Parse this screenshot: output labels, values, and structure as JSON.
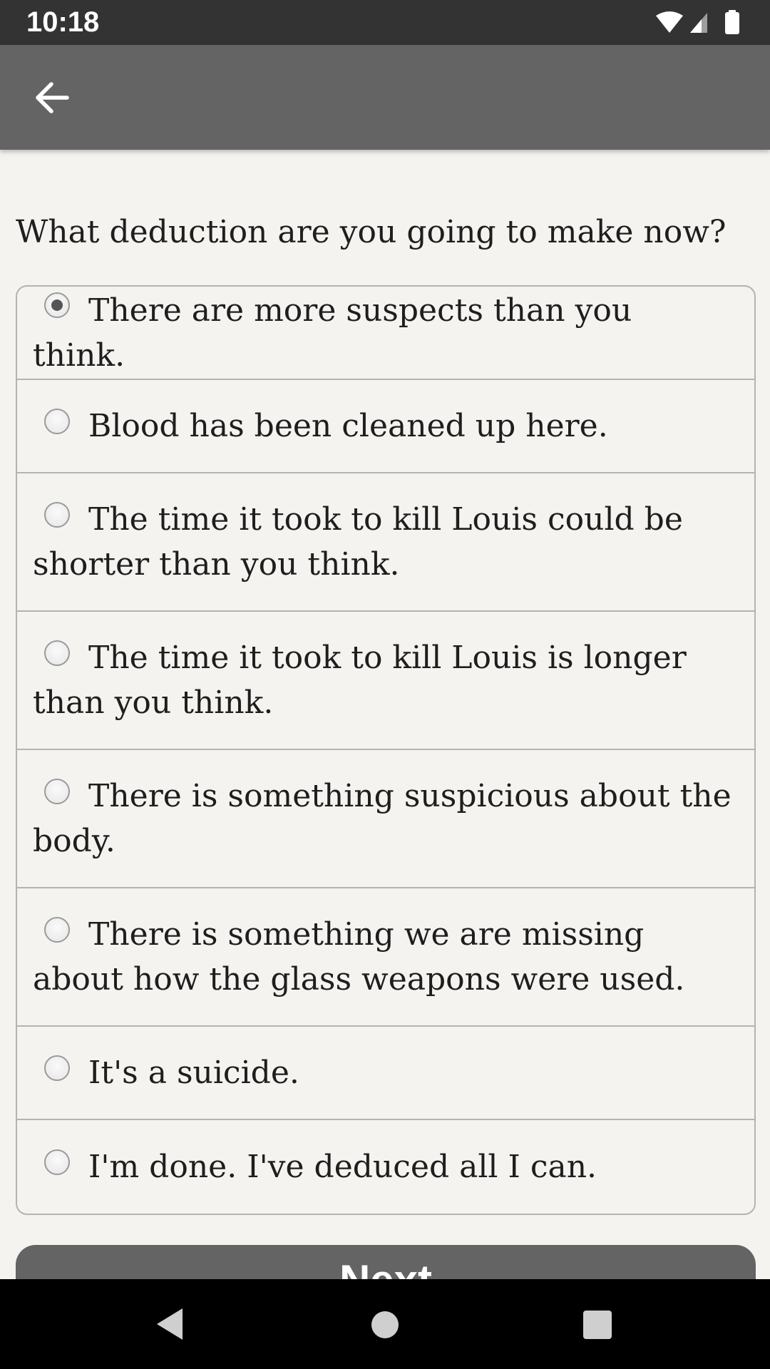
{
  "status_bar": {
    "time": "10:18",
    "icons": [
      "wifi-icon",
      "signal-icon",
      "battery-icon"
    ]
  },
  "app_bar": {
    "back_icon": "arrow-back-icon"
  },
  "question": "What deduction are you going to make now?",
  "options": [
    {
      "label": "There are more suspects than you think.",
      "selected": true
    },
    {
      "label": "Blood has been cleaned up here.",
      "selected": false
    },
    {
      "label": "The time it took to kill Louis could be shorter than you think.",
      "selected": false
    },
    {
      "label": "The time it took to kill Louis is longer than you think.",
      "selected": false
    },
    {
      "label": "There is something suspicious about the body.",
      "selected": false
    },
    {
      "label": "There is something we are missing about how the glass weapons were used.",
      "selected": false
    },
    {
      "label": "It's a suicide.",
      "selected": false
    },
    {
      "label": "I'm done. I've deduced all I can.",
      "selected": false
    }
  ],
  "next_button": {
    "label": "Next"
  },
  "nav_bar": {
    "icons": [
      "nav-back-icon",
      "nav-home-icon",
      "nav-recents-icon"
    ]
  },
  "colors": {
    "status_bar": "#333333",
    "app_bar": "#646464",
    "background": "#f5f3f0",
    "border": "#b3b3b3",
    "button": "#646464",
    "nav_bar": "#000000"
  }
}
